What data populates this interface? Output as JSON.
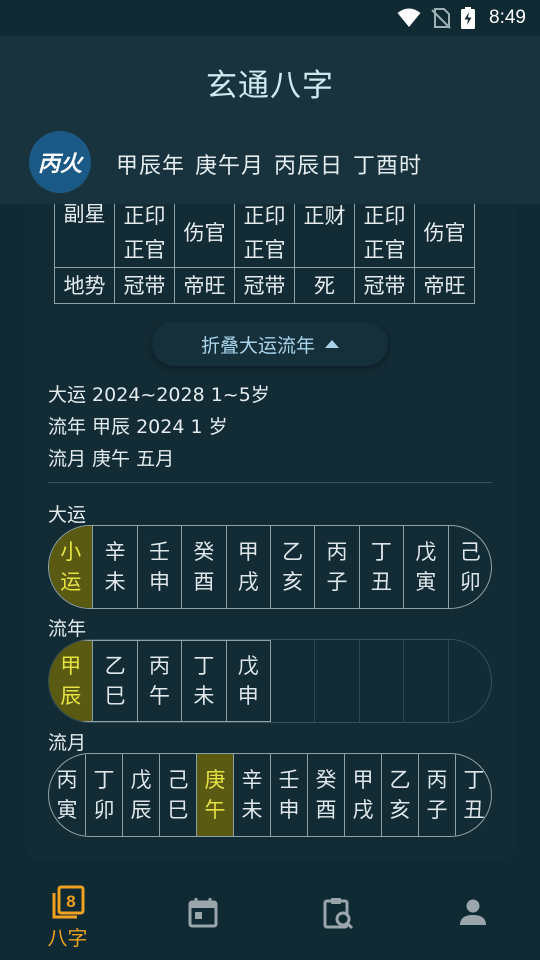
{
  "status_bar": {
    "time": "8:49",
    "icons": [
      "wifi-icon",
      "no-sim-icon",
      "battery-charging-icon"
    ]
  },
  "app": {
    "title": "玄通八字"
  },
  "profile": {
    "day_master": "丙火",
    "pillars": [
      "甲辰年",
      "庚午月",
      "丙辰日",
      "丁酉时"
    ]
  },
  "table": {
    "rows": [
      {
        "label": "副星",
        "cells": [
          [
            "正印",
            "正官"
          ],
          [
            "伤官"
          ],
          [
            "正印",
            "正官"
          ],
          [
            "正财"
          ],
          [
            "正印",
            "正官"
          ],
          [
            "伤官"
          ]
        ]
      },
      {
        "label": "地势",
        "cells": [
          [
            "冠带"
          ],
          [
            "帝旺"
          ],
          [
            "冠带"
          ],
          [
            "死"
          ],
          [
            "冠带"
          ],
          [
            "帝旺"
          ]
        ]
      }
    ]
  },
  "collapse_button": {
    "label": "折叠大运流年",
    "icon": "caret-up-icon"
  },
  "info": {
    "dayun": "大运  2024~2028 1~5岁",
    "liunian": "流年 甲辰 2024 1 岁",
    "liuyue": "流月 庚午 五月"
  },
  "sections": {
    "dayun_label": "大运",
    "liunian_label": "流年",
    "liuyue_label": "流月"
  },
  "dayun_cells": [
    [
      "小",
      "运"
    ],
    [
      "辛",
      "未"
    ],
    [
      "壬",
      "申"
    ],
    [
      "癸",
      "酉"
    ],
    [
      "甲",
      "戌"
    ],
    [
      "乙",
      "亥"
    ],
    [
      "丙",
      "子"
    ],
    [
      "丁",
      "丑"
    ],
    [
      "戊",
      "寅"
    ],
    [
      "己",
      "卯"
    ]
  ],
  "liunian_cells": [
    [
      "甲",
      "辰"
    ],
    [
      "乙",
      "巳"
    ],
    [
      "丙",
      "午"
    ],
    [
      "丁",
      "未"
    ],
    [
      "戊",
      "申"
    ]
  ],
  "liuyue_cells": [
    [
      "丙",
      "寅"
    ],
    [
      "丁",
      "卯"
    ],
    [
      "戊",
      "辰"
    ],
    [
      "己",
      "巳"
    ],
    [
      "庚",
      "午"
    ],
    [
      "辛",
      "未"
    ],
    [
      "壬",
      "申"
    ],
    [
      "癸",
      "酉"
    ],
    [
      "甲",
      "戌"
    ],
    [
      "乙",
      "亥"
    ],
    [
      "丙",
      "子"
    ],
    [
      "丁",
      "丑"
    ]
  ],
  "active": {
    "dayun_index": 0,
    "liunian_index": 0,
    "liuyue_index": 4
  },
  "nav": [
    {
      "label": "八字",
      "icon": "bazi-book-icon",
      "active": true
    },
    {
      "label": "",
      "icon": "calendar-icon",
      "active": false
    },
    {
      "label": "",
      "icon": "clipboard-search-icon",
      "active": false
    },
    {
      "label": "",
      "icon": "person-icon",
      "active": false
    }
  ],
  "colors": {
    "background": "#0f2a33",
    "header": "#18333d",
    "accent": "#f0a120",
    "active_cell": "#5a5a12",
    "active_text": "#e5e244",
    "day_master_badge": "#1b5a86",
    "link": "#a9d4ec"
  }
}
